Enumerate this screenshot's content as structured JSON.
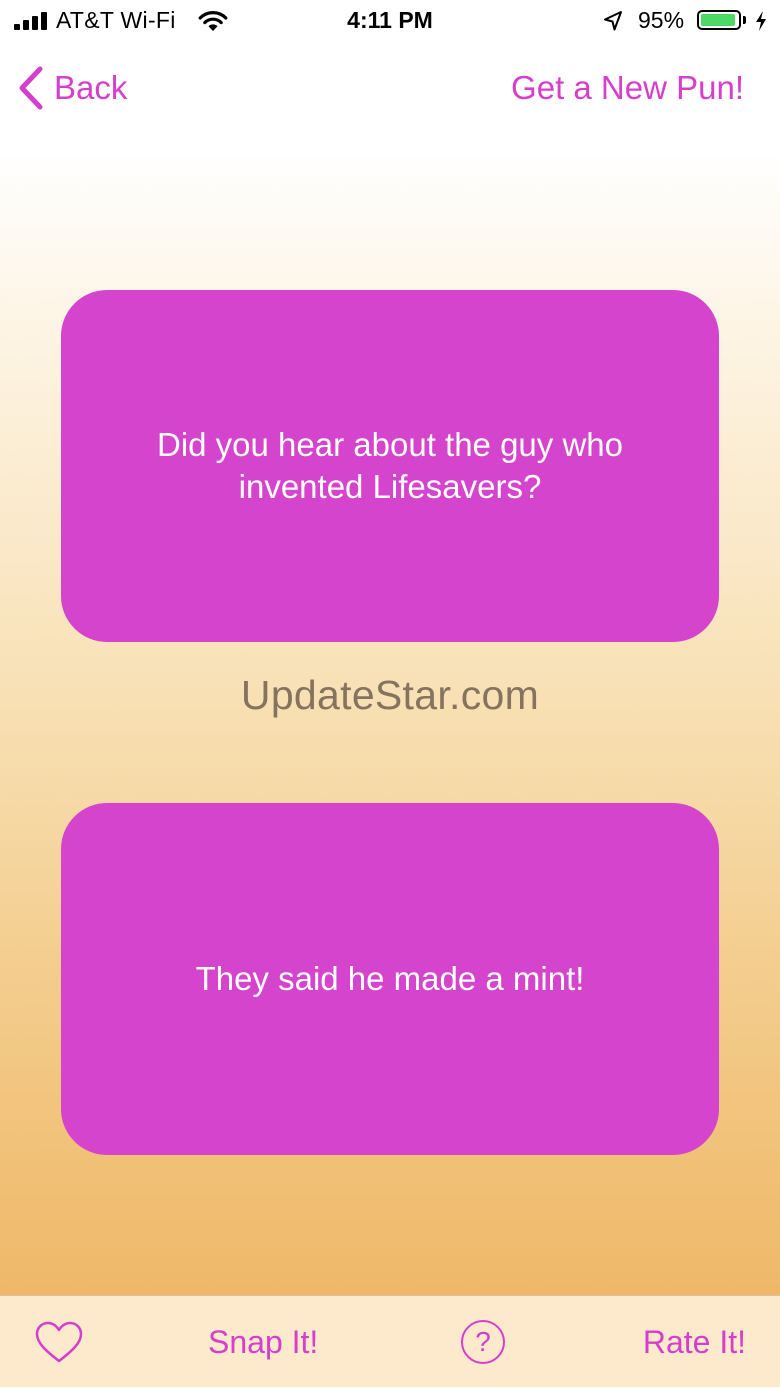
{
  "status_bar": {
    "carrier": "AT&T Wi-Fi",
    "time": "4:11 PM",
    "battery_percent": "95%",
    "battery_level": 0.95,
    "icons": [
      "signal-bars-icon",
      "wifi-icon",
      "location-arrow-icon",
      "battery-icon",
      "charging-bolt-icon"
    ]
  },
  "nav": {
    "back_label": "Back",
    "new_pun_label": "Get a New Pun!"
  },
  "pun": {
    "question": "Did you hear about the guy who invented Lifesavers?",
    "answer": "They said he made a mint!"
  },
  "watermark": "UpdateStar.com",
  "toolbar": {
    "snap_label": "Snap It!",
    "help_symbol": "?",
    "rate_label": "Rate It!",
    "icons": [
      "heart-icon",
      "help-icon"
    ]
  },
  "colors": {
    "accent": "#d63fcb",
    "card": "#d544cc",
    "toolbar_bg": "#fde9cc",
    "battery_fill": "#4cd964"
  }
}
